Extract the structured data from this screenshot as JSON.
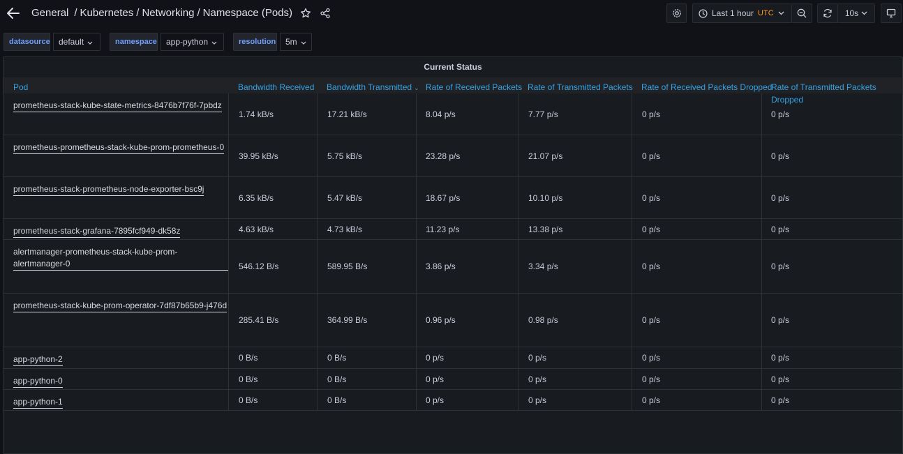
{
  "header": {
    "breadcrumb": [
      "General",
      "Kubernetes",
      "Networking",
      "Namespace (Pods)"
    ],
    "breadcrumb_sep": "/",
    "time_range": "Last 1 hour",
    "timezone": "UTC",
    "refresh_interval": "10s"
  },
  "variables": [
    {
      "label": "datasource",
      "value": "default"
    },
    {
      "label": "namespace",
      "value": "app-python"
    },
    {
      "label": "resolution",
      "value": "5m"
    }
  ],
  "panel": {
    "title": "Current Status",
    "columns": [
      "Pod",
      "Bandwidth Received",
      "Bandwidth Transmitted",
      "Rate of Received Packets",
      "Rate of Transmitted Packets",
      "Rate of Received Packets Dropped",
      "Rate of Transmitted Packets Dropped"
    ],
    "rows": [
      [
        "prometheus-stack-kube-state-metrics-8476b7f76f-7pbdz",
        "1.74 kB/s",
        "17.21 kB/s",
        "8.04 p/s",
        "7.77 p/s",
        "0 p/s",
        "0 p/s"
      ],
      [
        "prometheus-prometheus-stack-kube-prom-prometheus-0",
        "39.95 kB/s",
        "5.75 kB/s",
        "23.28 p/s",
        "21.07 p/s",
        "0 p/s",
        "0 p/s"
      ],
      [
        "prometheus-stack-prometheus-node-exporter-bsc9j",
        "6.35 kB/s",
        "5.47 kB/s",
        "18.67 p/s",
        "10.10 p/s",
        "0 p/s",
        "0 p/s"
      ],
      [
        "prometheus-stack-grafana-7895fcf949-dk58z",
        "4.63 kB/s",
        "4.73 kB/s",
        "11.23 p/s",
        "13.38 p/s",
        "0 p/s",
        "0 p/s"
      ],
      [
        "alertmanager-prometheus-stack-kube-prom-alertmanager-0",
        "546.12 B/s",
        "589.95 B/s",
        "3.86 p/s",
        "3.34 p/s",
        "0 p/s",
        "0 p/s"
      ],
      [
        "prometheus-stack-kube-prom-operator-7df87b65b9-j476d",
        "285.41 B/s",
        "364.99 B/s",
        "0.96 p/s",
        "0.98 p/s",
        "0 p/s",
        "0 p/s"
      ],
      [
        "app-python-2",
        "0 B/s",
        "0 B/s",
        "0 p/s",
        "0 p/s",
        "0 p/s",
        "0 p/s"
      ],
      [
        "app-python-0",
        "0 B/s",
        "0 B/s",
        "0 p/s",
        "0 p/s",
        "0 p/s",
        "0 p/s"
      ],
      [
        "app-python-1",
        "0 B/s",
        "0 B/s",
        "0 p/s",
        "0 p/s",
        "0 p/s",
        "0 p/s"
      ]
    ]
  },
  "colors": {
    "accent": "#33a2e5",
    "timezone": "#ff9830",
    "variable_label": "#6e9fff"
  }
}
